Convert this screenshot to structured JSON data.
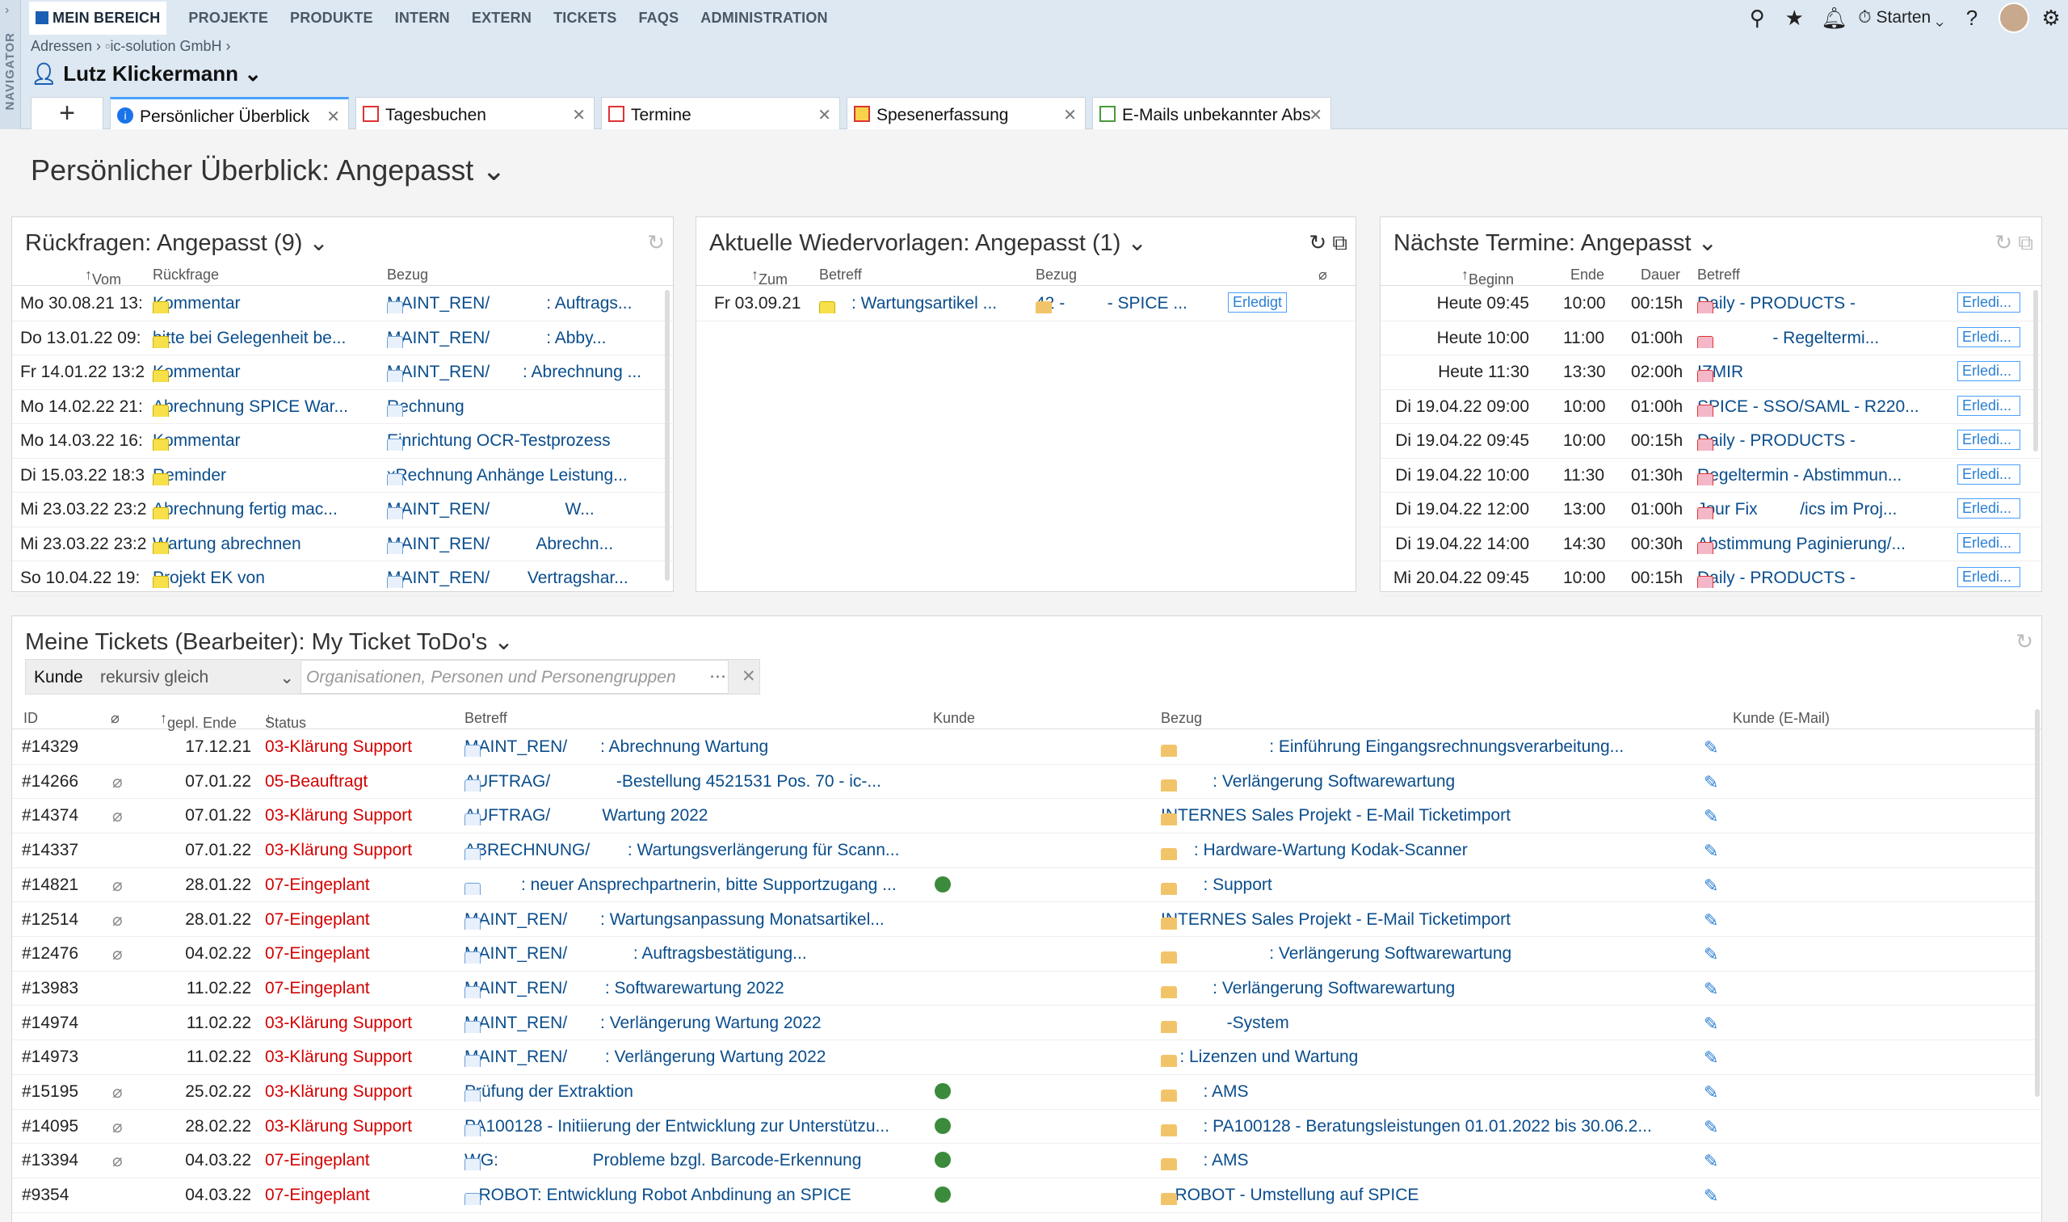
{
  "nav": {
    "side_label": "NAVIGATOR",
    "menu": [
      "MEIN BEREICH",
      "PROJEKTE",
      "PRODUKTE",
      "INTERN",
      "EXTERN",
      "TICKETS",
      "FAQS",
      "ADMINISTRATION"
    ],
    "starten": "Starten"
  },
  "breadcrumb": {
    "a": "Adressen",
    "b": "ic-solution GmbH"
  },
  "person": "Lutz Klickermann",
  "tabs": [
    "Persönlicher Überblick",
    "Tagesbuchen",
    "Termine",
    "Spesenerfassung",
    "E-Mails unbekannter Abs"
  ],
  "page_title": "Persönlicher Überblick: Angepasst",
  "rueckfragen": {
    "title": "Rückfragen: Angepasst (9)",
    "cols": [
      "Vom",
      "Rückfrage",
      "Bezug"
    ],
    "rows": [
      {
        "vom": "Mo 30.08.21 13:",
        "rf": "Kommentar",
        "bezug": "MAINT_REN/            : Auftrags..."
      },
      {
        "vom": "Do 13.01.22 09:",
        "rf": "bitte bei Gelegenheit be...",
        "bezug": "MAINT_REN/            : Abby..."
      },
      {
        "vom": "Fr 14.01.22 13:2",
        "rf": "Kommentar",
        "bezug": "MAINT_REN/       : Abrechnung ..."
      },
      {
        "vom": "Mo 14.02.22 21:",
        "rf": "Abrechnung SPICE War...",
        "bezug": "Rechnung"
      },
      {
        "vom": "Mo 14.03.22 16:",
        "rf": "Kommentar",
        "bezug": "Einrichtung OCR-Testprozess"
      },
      {
        "vom": "Di 15.03.22 18:3",
        "rf": "Reminder",
        "bezug": "xRechnung Anhänge Leistung..."
      },
      {
        "vom": "Mi 23.03.22 23:2",
        "rf": "Abrechnung fertig mac...",
        "bezug": "MAINT_REN/                W..."
      },
      {
        "vom": "Mi 23.03.22 23:2",
        "rf": "Wartung abrechnen",
        "bezug": "MAINT_REN/          Abrechn..."
      },
      {
        "vom": "So 10.04.22 19:",
        "rf": "Projekt EK von",
        "bezug": "MAINT_REN/        Vertragshar..."
      }
    ]
  },
  "wiedervorlagen": {
    "title": "Aktuelle Wiedervorlagen: Angepasst (1)",
    "cols": [
      "Zum",
      "Betreff",
      "Bezug"
    ],
    "rows": [
      {
        "zum": "Fr 03.09.21",
        "betreff": ": Wartungsartikel ...",
        "bezug": "42 -         - SPICE ...",
        "btn": "Erledigt"
      }
    ]
  },
  "termine": {
    "title": "Nächste Termine: Angepasst",
    "cols": [
      "Beginn",
      "Ende",
      "Dauer",
      "Betreff"
    ],
    "rows": [
      {
        "b": "Heute 09:45",
        "e": "10:00",
        "d": "00:15h",
        "t": "Daily - PRODUCTS -",
        "btn": "Erledi..."
      },
      {
        "b": "Heute 10:00",
        "e": "11:00",
        "d": "01:00h",
        "t": "                - Regeltermi...",
        "btn": "Erledi..."
      },
      {
        "b": "Heute 11:30",
        "e": "13:30",
        "d": "02:00h",
        "t": "IZMIR",
        "btn": "Erledi..."
      },
      {
        "b": "Di 19.04.22 09:00",
        "e": "10:00",
        "d": "01:00h",
        "t": "SPICE - SSO/SAML - R220...",
        "btn": "Erledi..."
      },
      {
        "b": "Di 19.04.22 09:45",
        "e": "10:00",
        "d": "00:15h",
        "t": "Daily - PRODUCTS -",
        "btn": "Erledi..."
      },
      {
        "b": "Di 19.04.22 10:00",
        "e": "11:30",
        "d": "01:30h",
        "t": "Regeltermin - Abstimmun...",
        "btn": "Erledi..."
      },
      {
        "b": "Di 19.04.22 12:00",
        "e": "13:00",
        "d": "01:00h",
        "t": "Jour Fix         /ics im Proj...",
        "btn": "Erledi..."
      },
      {
        "b": "Di 19.04.22 14:00",
        "e": "14:30",
        "d": "00:30h",
        "t": "Abstimmung Paginierung/...",
        "btn": "Erledi..."
      },
      {
        "b": "Mi 20.04.22 09:45",
        "e": "10:00",
        "d": "00:15h",
        "t": "Daily - PRODUCTS -",
        "btn": "Erledi..."
      }
    ]
  },
  "tickets": {
    "title": "Meine Tickets (Bearbeiter): My Ticket ToDo's",
    "filter_label": "Kunde",
    "filter_op": "rekursiv gleich",
    "filter_placeholder": "Organisationen, Personen und Personengruppen",
    "cols": [
      "ID",
      "gepl. Ende",
      "Status",
      "Betreff",
      "Kunde",
      "Bezug",
      "Kunde (E-Mail)"
    ],
    "rows": [
      {
        "id": "#14329",
        "clip": false,
        "end": "17.12.21",
        "status": "03-Klärung Support",
        "betreff": "MAINT_REN/       : Abrechnung Wartung",
        "kunde": false,
        "bezug": "                       : Einführung Eingangsrechnungsverarbeitung..."
      },
      {
        "id": "#14266",
        "clip": true,
        "end": "07.01.22",
        "status": "05-Beauftragt",
        "betreff": "AUFTRAG/              -Bestellung 4521531 Pos. 70 - ic-...",
        "kunde": false,
        "bezug": "           : Verlängerung Softwarewartung"
      },
      {
        "id": "#14374",
        "clip": true,
        "end": "07.01.22",
        "status": "03-Klärung Support",
        "betreff": "AUFTRAG/           Wartung 2022",
        "kunde": false,
        "bezug": "INTERNES Sales Projekt - E-Mail Ticketimport"
      },
      {
        "id": "#14337",
        "clip": false,
        "end": "07.01.22",
        "status": "03-Klärung Support",
        "betreff": "ABRECHNUNG/        : Wartungsverlängerung für Scann...",
        "kunde": false,
        "bezug": "       : Hardware-Wartung Kodak-Scanner"
      },
      {
        "id": "#14821",
        "clip": true,
        "end": "28.01.22",
        "status": "07-Eingeplant",
        "betreff": "            : neuer Ansprechpartnerin, bitte Supportzugang ...",
        "kunde": true,
        "bezug": "         : Support"
      },
      {
        "id": "#12514",
        "clip": true,
        "end": "28.01.22",
        "status": "07-Eingeplant",
        "betreff": "MAINT_REN/       : Wartungsanpassung Monatsartikel...",
        "kunde": false,
        "bezug": "INTERNES Sales Projekt - E-Mail Ticketimport"
      },
      {
        "id": "#12476",
        "clip": true,
        "end": "04.02.22",
        "status": "07-Eingeplant",
        "betreff": "MAINT_REN/              : Auftragsbestätigung...",
        "kunde": false,
        "bezug": "                       : Verlängerung Softwarewartung"
      },
      {
        "id": "#13983",
        "clip": false,
        "end": "11.02.22",
        "status": "07-Eingeplant",
        "betreff": "MAINT_REN/        : Softwarewartung 2022",
        "kunde": false,
        "bezug": "           : Verlängerung Softwarewartung"
      },
      {
        "id": "#14974",
        "clip": false,
        "end": "11.02.22",
        "status": "03-Klärung Support",
        "betreff": "MAINT_REN/       : Verlängerung Wartung 2022",
        "kunde": false,
        "bezug": "              -System"
      },
      {
        "id": "#14973",
        "clip": false,
        "end": "11.02.22",
        "status": "03-Klärung Support",
        "betreff": "MAINT_REN/        : Verlängerung Wartung 2022",
        "kunde": false,
        "bezug": "    : Lizenzen und Wartung"
      },
      {
        "id": "#15195",
        "clip": true,
        "end": "25.02.22",
        "status": "03-Klärung Support",
        "betreff": "Prüfung der Extraktion",
        "kunde": true,
        "bezug": "         : AMS"
      },
      {
        "id": "#14095",
        "clip": true,
        "end": "28.02.22",
        "status": "03-Klärung Support",
        "betreff": "PA100128 - Initiierung der Entwicklung zur Unterstützu...",
        "kunde": true,
        "bezug": "         : PA100128 - Beratungsleistungen 01.01.2022 bis 30.06.2..."
      },
      {
        "id": "#13394",
        "clip": true,
        "end": "04.03.22",
        "status": "07-Eingeplant",
        "betreff": "WG:                    Probleme bzgl. Barcode-Erkennung",
        "kunde": true,
        "bezug": "         : AMS"
      },
      {
        "id": "#9354",
        "clip": false,
        "end": "04.03.22",
        "status": "07-Eingeplant",
        "betreff": "   ROBOT: Entwicklung Robot Anbdinung an SPICE",
        "kunde": true,
        "bezug": "   ROBOT - Umstellung auf SPICE"
      }
    ]
  }
}
